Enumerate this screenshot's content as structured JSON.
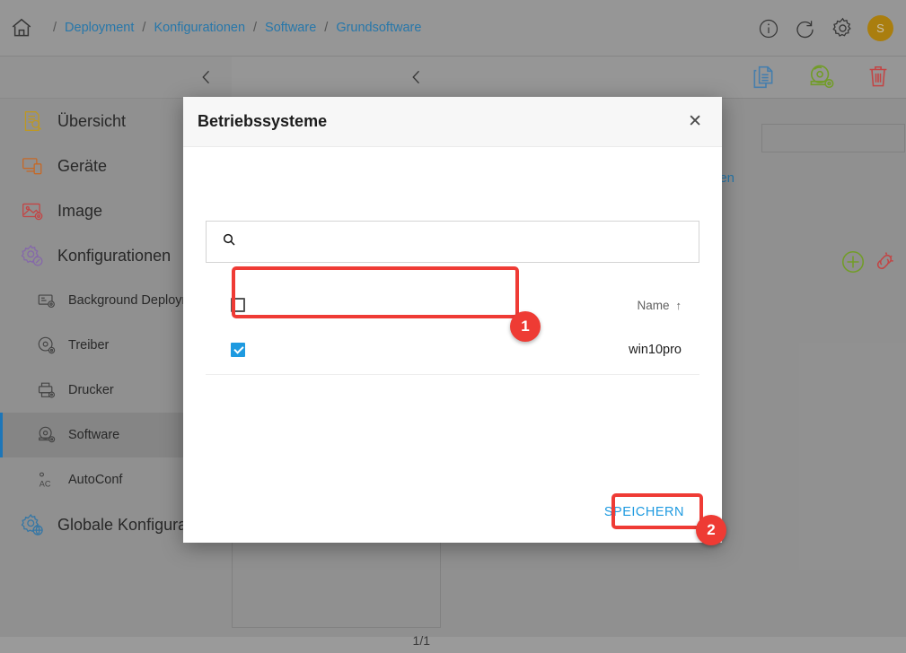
{
  "topbar": {
    "home_icon": "home-icon",
    "breadcrumb": [
      {
        "label": "Deployment",
        "link": true
      },
      {
        "label": "Konfigurationen",
        "link": true
      },
      {
        "label": "Software",
        "link": true
      },
      {
        "label": "Grundsoftware",
        "link": true
      }
    ],
    "separator": "/",
    "icons": [
      {
        "name": "info-icon",
        "glyph": "i"
      },
      {
        "name": "refresh-icon",
        "glyph": "refresh"
      },
      {
        "name": "settings-gear-icon",
        "glyph": "gear"
      }
    ],
    "avatar_initial": "S",
    "avatar_color": "#b5860f"
  },
  "sidebar": {
    "collapse_icon": "chevron-left-icon",
    "items": [
      {
        "label": "Übersicht",
        "icon": "overview-icon",
        "level": 0,
        "active": false,
        "color": "#c9a227"
      },
      {
        "label": "Geräte",
        "icon": "devices-icon",
        "level": 0,
        "active": false,
        "color": "#d2702a"
      },
      {
        "label": "Image",
        "icon": "image-icon",
        "level": 0,
        "active": false,
        "color": "#cf4a4a"
      },
      {
        "label": "Konfigurationen",
        "icon": "configurations-gear-icon",
        "level": 0,
        "active": false,
        "color": "#8e6fb5"
      },
      {
        "label": "Background Deployment",
        "icon": "background-deployment-icon",
        "level": 1,
        "active": false,
        "color": "#4a4a4a"
      },
      {
        "label": "Treiber",
        "icon": "driver-disc-icon",
        "level": 1,
        "active": false,
        "color": "#4a4a4a"
      },
      {
        "label": "Drucker",
        "icon": "printer-icon",
        "level": 1,
        "active": false,
        "color": "#4a4a4a"
      },
      {
        "label": "Software",
        "icon": "software-disc-icon",
        "level": 1,
        "active": true,
        "color": "#4a4a4a"
      },
      {
        "label": "AutoConf",
        "icon": "autoconf-icon",
        "level": 1,
        "active": false,
        "color": "#4a4a4a"
      },
      {
        "label": "Globale Konfiguration",
        "icon": "global-configuration-icon",
        "level": 0,
        "active": false,
        "color": "#3a7fb0"
      }
    ],
    "active_accent": "#1f7ec4"
  },
  "content": {
    "back_icon": "chevron-left-icon",
    "actions": [
      {
        "name": "copy-icon",
        "color": "#4a86b8"
      },
      {
        "name": "software-disc-icon",
        "color": "#7aa62c"
      },
      {
        "name": "delete-trash-icon",
        "color": "#cf4a4a"
      }
    ],
    "link_text_partial": "eren",
    "add_icon": "add-circle-icon",
    "unlink_icon": "unlink-icon",
    "pagination": "1/1"
  },
  "modal": {
    "title": "Betriebssysteme",
    "close_icon": "close-icon",
    "search": {
      "icon": "search-icon",
      "value": "",
      "placeholder": ""
    },
    "table": {
      "select_all_checked": false,
      "columns": [
        "Name"
      ],
      "sort_indicator": "↑",
      "rows": [
        {
          "checked": true,
          "name": "win10pro"
        }
      ]
    },
    "save_label": "SPEICHERN"
  },
  "annotations": [
    {
      "id": 1,
      "label": "1",
      "target": "selected-row"
    },
    {
      "id": 2,
      "label": "2",
      "target": "save-button"
    }
  ]
}
